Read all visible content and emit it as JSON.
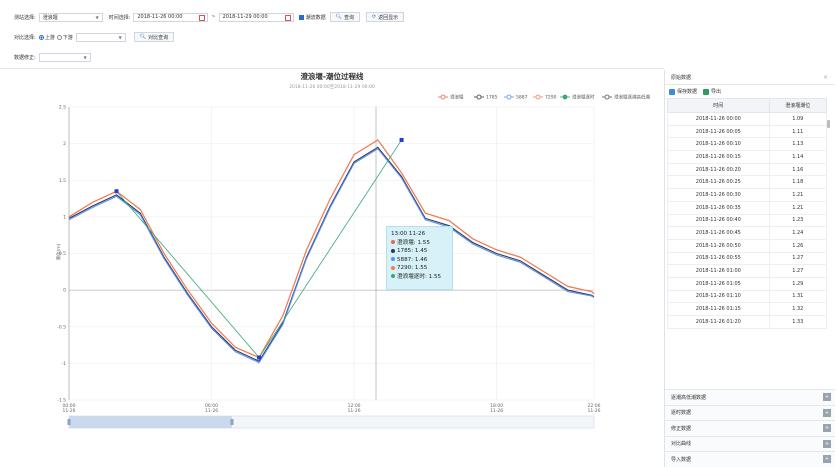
{
  "toolbar": {
    "station_label": "测站选择:",
    "station_value": "澄浪堰",
    "time_label": "时间选择:",
    "start_date": "2018-11-26 00:00",
    "end_date": "2018-11-29 00:00",
    "date_sep": "~",
    "tide_checkbox_label": "潮流数据",
    "query_label": "查询",
    "back_label": "返回显示",
    "compare_label": "对比选择:",
    "radio_up": "上游",
    "radio_down": "下游",
    "compare_query_label": "对比查询",
    "correction_label": "数据修正:"
  },
  "colors": {
    "red": "#e8684a",
    "dark": "#2b3a55",
    "teal": "#5b8ff9",
    "green": "#3aa774",
    "orange": "#f07f56",
    "accent": "#2a6bc7"
  },
  "chart_data": {
    "type": "line",
    "title": "澄浪堰-潮位过程线",
    "subtitle": "2018-11-26 00:00至2018-11-29 00:00",
    "xlabel": "",
    "ylabel": "潮位(m)",
    "ylim": [
      -1.5,
      2.5
    ],
    "yticks": [
      "2.5",
      "2",
      "1.5",
      "1",
      "0.5",
      "0",
      "-0.5",
      "-1",
      "-1.5"
    ],
    "xticks": [
      {
        "t": "00:00",
        "d": "11-26"
      },
      {
        "t": "06:00",
        "d": "11-26"
      },
      {
        "t": "12:00",
        "d": "11-26"
      },
      {
        "t": "18:00",
        "d": "11-26"
      },
      {
        "t": "22:06",
        "d": "11-26"
      }
    ],
    "x_hours": [
      0,
      1,
      2,
      3,
      4,
      5,
      6,
      7,
      8,
      9,
      10,
      11,
      12,
      13,
      14,
      15,
      16,
      17,
      18,
      19,
      20,
      21,
      22,
      22.1
    ],
    "series": [
      {
        "name": "澄浪堰",
        "color": "#e8684a",
        "values": [
          1.0,
          1.2,
          1.35,
          1.1,
          0.5,
          0.0,
          -0.45,
          -0.78,
          -0.92,
          -0.35,
          0.55,
          1.25,
          1.85,
          2.05,
          1.6,
          1.05,
          0.95,
          0.7,
          0.55,
          0.45,
          0.25,
          0.05,
          -0.02,
          -0.05
        ]
      },
      {
        "name": "1785",
        "color": "#2b3a55",
        "values": [
          0.98,
          1.15,
          1.3,
          1.05,
          0.45,
          -0.05,
          -0.5,
          -0.82,
          -0.97,
          -0.45,
          0.45,
          1.15,
          1.75,
          1.95,
          1.55,
          0.98,
          0.88,
          0.65,
          0.5,
          0.4,
          0.2,
          0.0,
          -0.07,
          -0.09
        ]
      },
      {
        "name": "5887",
        "color": "#5b8ff9",
        "values": [
          0.96,
          1.13,
          1.28,
          1.03,
          0.43,
          -0.07,
          -0.52,
          -0.84,
          -0.99,
          -0.47,
          0.43,
          1.13,
          1.73,
          1.93,
          1.53,
          0.96,
          0.86,
          0.63,
          0.48,
          0.38,
          0.18,
          -0.02,
          -0.08,
          -0.1
        ]
      },
      {
        "name": "7290",
        "color": "#f07f56",
        "values": [
          1.0,
          1.2,
          1.35,
          1.1,
          0.5,
          0.0,
          -0.45,
          -0.78,
          -0.92,
          -0.35,
          0.55,
          1.25,
          1.85,
          2.05,
          1.6,
          1.05,
          0.95,
          0.7,
          0.55,
          0.45,
          0.25,
          0.05,
          -0.02,
          -0.05
        ]
      },
      {
        "name": "澄浪堰逐时",
        "color": "#3aa774",
        "x": [
          2.0,
          8.0,
          14.0
        ],
        "values": [
          1.35,
          -0.92,
          2.05
        ]
      }
    ],
    "legend": [
      "澄浪堰",
      "1785",
      "5887",
      "7290",
      "澄浪堰逐时",
      "澄浪堰逐潮高低潮"
    ],
    "legend_position": "top-right",
    "grid": true
  },
  "tooltip": {
    "title": "13:00 11-26",
    "rows": [
      {
        "label": "澄浪堰: 1.55",
        "color": "#e8684a"
      },
      {
        "label": "1785: 1.45",
        "color": "#2b3a55"
      },
      {
        "label": "5887: 1.46",
        "color": "#5b8ff9"
      },
      {
        "label": "7290: 1.55",
        "color": "#f07f56"
      },
      {
        "label": "澄浪堰逐时: 1.55",
        "color": "#3aa774"
      }
    ]
  },
  "panel": {
    "title": "原始数据",
    "save_label": "保存数据",
    "export_label": "导出",
    "col_time": "时间",
    "col_value": "澄浪堰潮位",
    "rows": [
      [
        "2018-11-26 00:00",
        "1.09"
      ],
      [
        "2018-11-26 00:05",
        "1.11"
      ],
      [
        "2018-11-26 00:10",
        "1.13"
      ],
      [
        "2018-11-26 00:15",
        "1.14"
      ],
      [
        "2018-11-26 00:20",
        "1.16"
      ],
      [
        "2018-11-26 00:25",
        "1.18"
      ],
      [
        "2018-11-26 00:30",
        "1.21"
      ],
      [
        "2018-11-26 00:35",
        "1.21"
      ],
      [
        "2018-11-26 00:40",
        "1.23"
      ],
      [
        "2018-11-26 00:45",
        "1.24"
      ],
      [
        "2018-11-26 00:50",
        "1.26"
      ],
      [
        "2018-11-26 00:55",
        "1.27"
      ],
      [
        "2018-11-26 01:00",
        "1.27"
      ],
      [
        "2018-11-26 01:05",
        "1.29"
      ],
      [
        "2018-11-26 01:10",
        "1.31"
      ],
      [
        "2018-11-26 01:15",
        "1.32"
      ],
      [
        "2018-11-26 01:20",
        "1.33"
      ]
    ],
    "accordion": [
      "逐潮高低潮数据",
      "逐时数据",
      "修正数据",
      "对比曲线",
      "导入数据"
    ]
  }
}
